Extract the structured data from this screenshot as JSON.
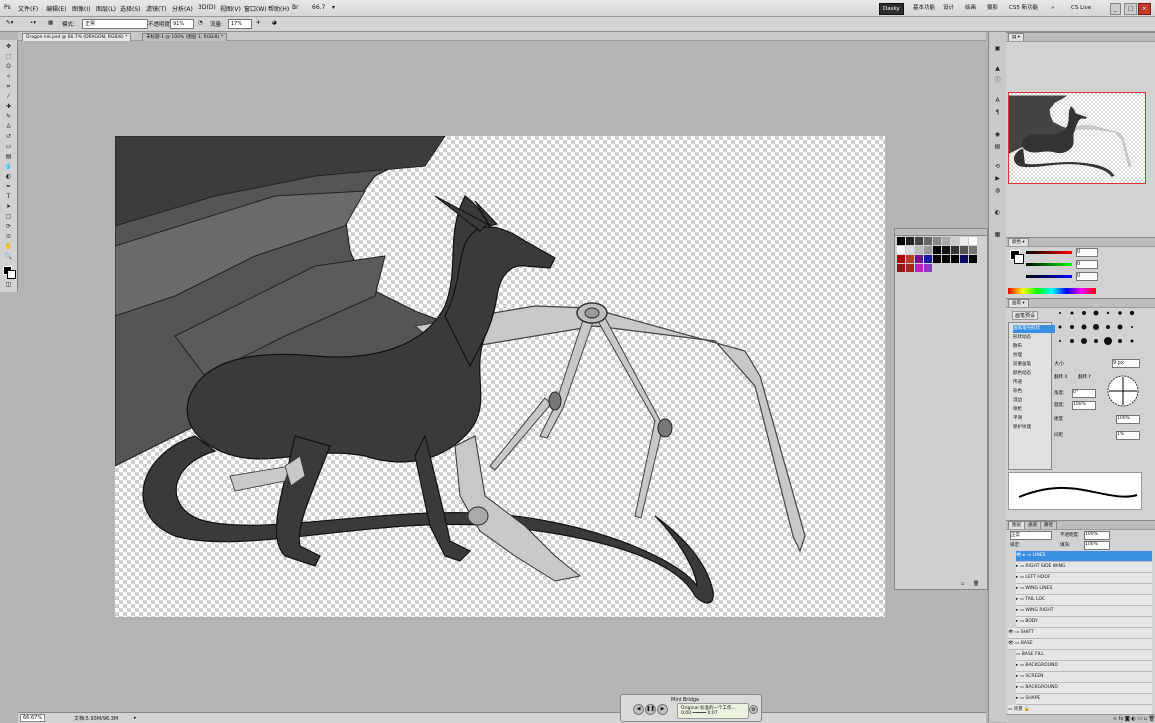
{
  "menubar": {
    "items": [
      "文件(F)",
      "编辑(E)",
      "图像(I)",
      "图层(L)",
      "选择(S)",
      "滤镜(T)",
      "分析(A)",
      "3D(D)",
      "视图(V)",
      "窗口(W)",
      "帮助(H)"
    ],
    "view_extras": [
      "66.7",
      "▾"
    ],
    "workspaces": [
      "Dasky",
      "基本功能",
      "设计",
      "绘画",
      "摄影",
      "CS5 新功能",
      "»"
    ],
    "search_label": "CS Live"
  },
  "options_bar": {
    "mode_label": "模式:",
    "mode_value": "正常",
    "opacity_label": "不透明度:",
    "opacity_value": "91%",
    "flow_label": "流量:",
    "flow_value": "17%"
  },
  "tabs": [
    {
      "label": "Dragon Ink.psd @ 66.7% (DRAGON, RGB/8) *",
      "active": true
    },
    {
      "label": "未标题-1 @ 100% (图层 1, RGB/8) *",
      "active": false
    }
  ],
  "status": {
    "zoom": "66.67%",
    "doc_info": "文档:5.93M/96.3M"
  },
  "colors": {
    "workspace_bg": "#b4b4b4",
    "selection": "#3a8fe0",
    "dragon_dark": "#3a3a3a",
    "wing_membrane": "#555555",
    "mech_gray": "#c8c8c8"
  },
  "color_panel": {
    "r": "0",
    "g": "0",
    "b": "0"
  },
  "brushes_panel": {
    "tab": "画笔预设",
    "presets": [
      "画笔笔尖形状",
      "形状动态",
      "散布",
      "纹理",
      "双重画笔",
      "颜色动态",
      "传递",
      "杂色",
      "湿边",
      "喷枪",
      "平滑",
      "保护纹理"
    ],
    "size_label": "大小",
    "size_value": "9 px",
    "angle_label": "角度:",
    "angle_value": "0°",
    "roundness_label": "圆度:",
    "roundness_value": "100%",
    "hardness_label": "硬度",
    "hardness_value": "100%",
    "spacing_label": "间距",
    "spacing_value": "1%",
    "flip_x": "翻转 X",
    "flip_y": "翻转 Y"
  },
  "layers_panel": {
    "tabs": [
      "图层",
      "通道",
      "路径"
    ],
    "blend_mode": "正常",
    "opacity_label": "不透明度:",
    "opacity_value": "100%",
    "lock_label": "锁定:",
    "fill_label": "填充:",
    "fill_value": "100%",
    "layers": [
      {
        "name": "LINES",
        "selected": true
      },
      {
        "name": "RIGHT SIDE WING"
      },
      {
        "name": "LEFT HOOF"
      },
      {
        "name": "WING LINES"
      },
      {
        "name": "TAIL LOC"
      },
      {
        "name": "WING RIGHT"
      },
      {
        "name": "BODY"
      },
      {
        "name": "SHIFT"
      },
      {
        "name": "BASE"
      },
      {
        "name": "BASE FILL"
      },
      {
        "name": "BACKGROUND"
      },
      {
        "name": "SCREEN"
      },
      {
        "name": "BACKGROUND"
      },
      {
        "name": "SHAPE"
      },
      {
        "name": "背景"
      }
    ]
  },
  "animation": {
    "title": "Mini Bridge",
    "line1": "Original 标准的一个工作...",
    "line2": "0:00 ━━━━━ 0:07"
  }
}
